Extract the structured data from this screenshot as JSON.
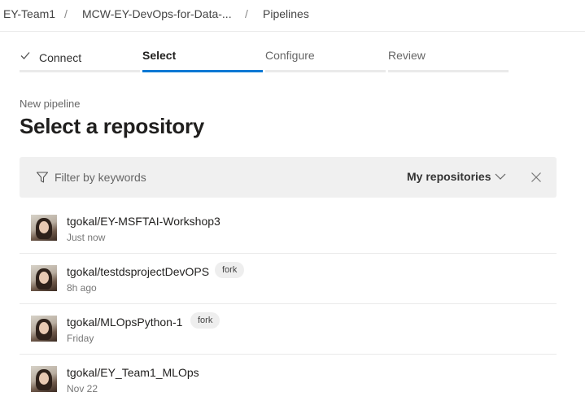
{
  "breadcrumb": {
    "items": [
      "EY-Team1",
      "MCW-EY-DevOps-for-Data-...",
      "Pipelines"
    ],
    "separator": "/"
  },
  "wizard": {
    "steps": [
      {
        "label": "Connect",
        "state": "completed",
        "icon": "checkmark-icon"
      },
      {
        "label": "Select",
        "state": "active"
      },
      {
        "label": "Configure",
        "state": "pending"
      },
      {
        "label": "Review",
        "state": "pending"
      }
    ],
    "accent_color": "#0078d4"
  },
  "page": {
    "subtitle": "New pipeline",
    "title": "Select a repository"
  },
  "filter": {
    "placeholder": "Filter by keywords",
    "scope": "My repositories",
    "icons": [
      "filter-icon",
      "chevron-down-icon",
      "close-icon"
    ]
  },
  "repos": [
    {
      "name": "tgokal/EY-MSFTAI-Workshop3",
      "time": "Just now",
      "badge": ""
    },
    {
      "name": "tgokal/testdsprojectDevOPS",
      "time": "8h ago",
      "badge": "fork"
    },
    {
      "name": "tgokal/MLOpsPython-1",
      "time": "Friday",
      "badge": "fork"
    },
    {
      "name": "tgokal/EY_Team1_MLOps",
      "time": "Nov 22",
      "badge": ""
    }
  ]
}
